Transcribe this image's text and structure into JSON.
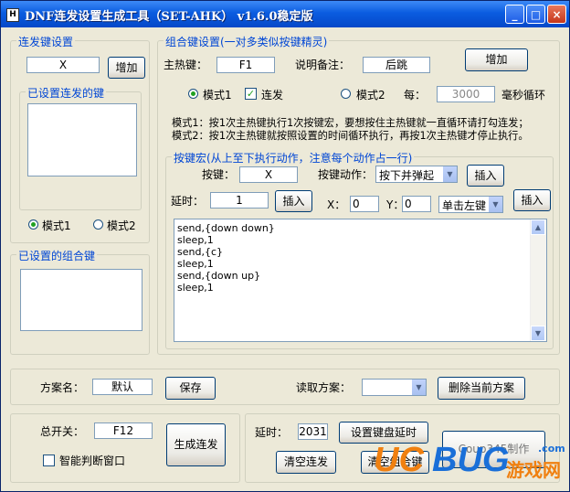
{
  "window": {
    "title": "DNF连发设置生成工具（SET-AHK） v1.6.0稳定版",
    "icon_letter": "H",
    "min_label": "_",
    "max_label": "□",
    "close_label": "×"
  },
  "lianfa": {
    "group_label": "连发键设置",
    "key_value": "X",
    "add_label": "增加",
    "set_group_label": "已设置连发的键",
    "mode1_label": "模式1",
    "mode2_label": "模式2"
  },
  "combo_set": {
    "group_label": "已设置的组合键"
  },
  "combo": {
    "group_label": "组合键设置(一对多类似按键精灵)",
    "hotkey_label": "主热键：",
    "hotkey_value": "F1",
    "note_label": "说明备注：",
    "note_value": "后跳",
    "add_label": "增加",
    "mode1_label": "模式1",
    "lianfa_label": "连发",
    "mode2_label": "模式2",
    "every_label": "每：",
    "every_value": "3000",
    "ms_label": "毫秒循环",
    "desc1": "模式1：按1次主热键执行1次按键宏，要想按住主热键就一直循环请打勾连发；",
    "desc2": "模式2：按1次主热键就按照设置的时间循环执行，再按1次主热键才停止执行。"
  },
  "macro": {
    "group_label": "按键宏(从上至下执行动作，注意每个动作占一行)",
    "key_label": "按键：",
    "key_value": "X",
    "action_label": "按键动作：",
    "action_value": "按下并弹起",
    "insert1": "插入",
    "delay_label": "延时：",
    "delay_value": "1",
    "insert2": "插入",
    "x_label": "X：",
    "x_value": "0",
    "y_label": "Y：",
    "y_value": "0",
    "click_value": "单击左键",
    "insert3": "插入",
    "lines": [
      "send,{down down}",
      "sleep,1",
      "send,{c}",
      "sleep,1",
      "send,{down up}",
      "sleep,1"
    ]
  },
  "scheme": {
    "name_label": "方案名：",
    "name_value": "默认",
    "save_label": "保存",
    "read_label": "读取方案：",
    "read_value": "",
    "delete_label": "删除当前方案"
  },
  "master": {
    "switch_label": "总开关：",
    "switch_value": "F12",
    "smart_label": "智能判断窗口",
    "generate_label": "生成连发"
  },
  "bottom": {
    "delay_label": "延时：",
    "delay_value": "2031",
    "set_delay_label": "设置键盘延时",
    "clear_label": "清空连发",
    "clear_combo_label": "清空组合键",
    "credit_label": "Coup345制作"
  },
  "watermark": {
    "part1": "UC",
    "part2": "BUG",
    "part3": "游戏网",
    "part4": ".com"
  },
  "colors": {
    "title_blue": "#0a5ce0",
    "group_label": "#0046d5",
    "radio_dot": "#21a121",
    "wm_orange": "#f08010",
    "wm_blue": "#1a6fd8"
  }
}
